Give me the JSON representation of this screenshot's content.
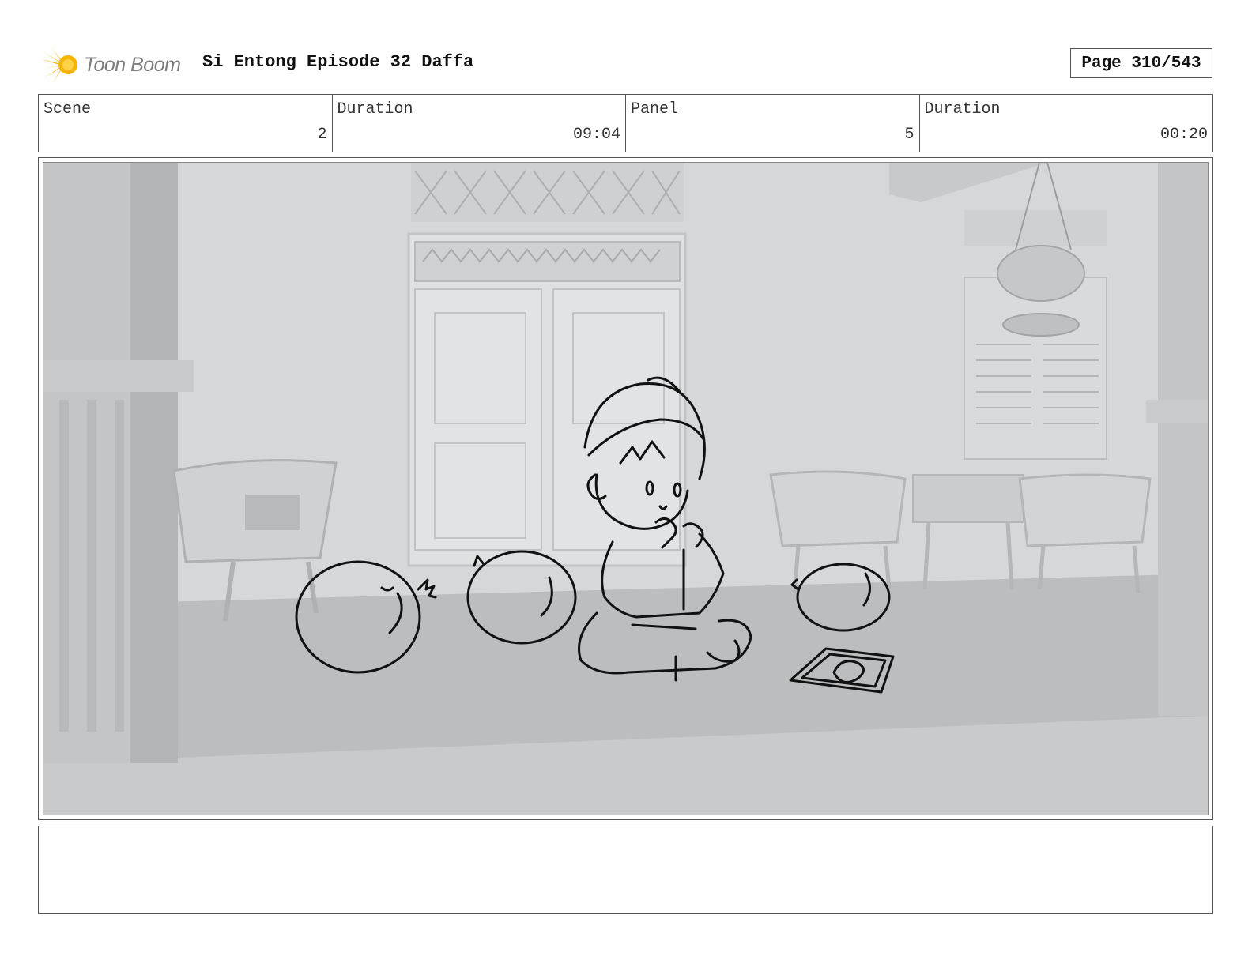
{
  "header": {
    "logo_text": "Toon Boom",
    "title": "Si Entong Episode 32 Daffa",
    "page_label": "Page 310/543"
  },
  "info": {
    "scene_label": "Scene",
    "scene_value": "2",
    "scene_duration_label": "Duration",
    "scene_duration_value": "09:04",
    "panel_label": "Panel",
    "panel_value": "5",
    "panel_duration_label": "Duration",
    "panel_duration_value": "00:20"
  },
  "panel": {
    "image_icon": "storyboard-sketch-image"
  },
  "notes": {
    "text": ""
  },
  "colors": {
    "logo_accent": "#f5b400",
    "border": "#555555",
    "background_render": "#d9dadb"
  }
}
